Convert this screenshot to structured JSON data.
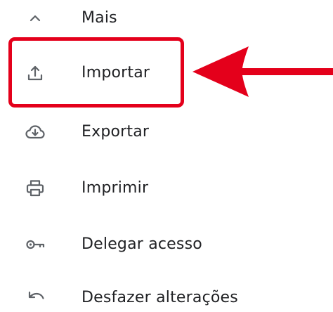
{
  "menu": {
    "items": [
      {
        "label": "Mais",
        "icon": "chevron-up-icon"
      },
      {
        "label": "Importar",
        "icon": "upload-icon"
      },
      {
        "label": "Exportar",
        "icon": "cloud-download-icon"
      },
      {
        "label": "Imprimir",
        "icon": "printer-icon"
      },
      {
        "label": "Delegar acesso",
        "icon": "key-icon"
      },
      {
        "label": "Desfazer alterações",
        "icon": "undo-icon"
      }
    ]
  },
  "colors": {
    "text": "#202124",
    "icon": "#5f6368",
    "annotation": "#e4001b",
    "background": "#ffffff"
  },
  "annotation": {
    "highlighted_item": "Importar",
    "arrow_direction": "left"
  }
}
